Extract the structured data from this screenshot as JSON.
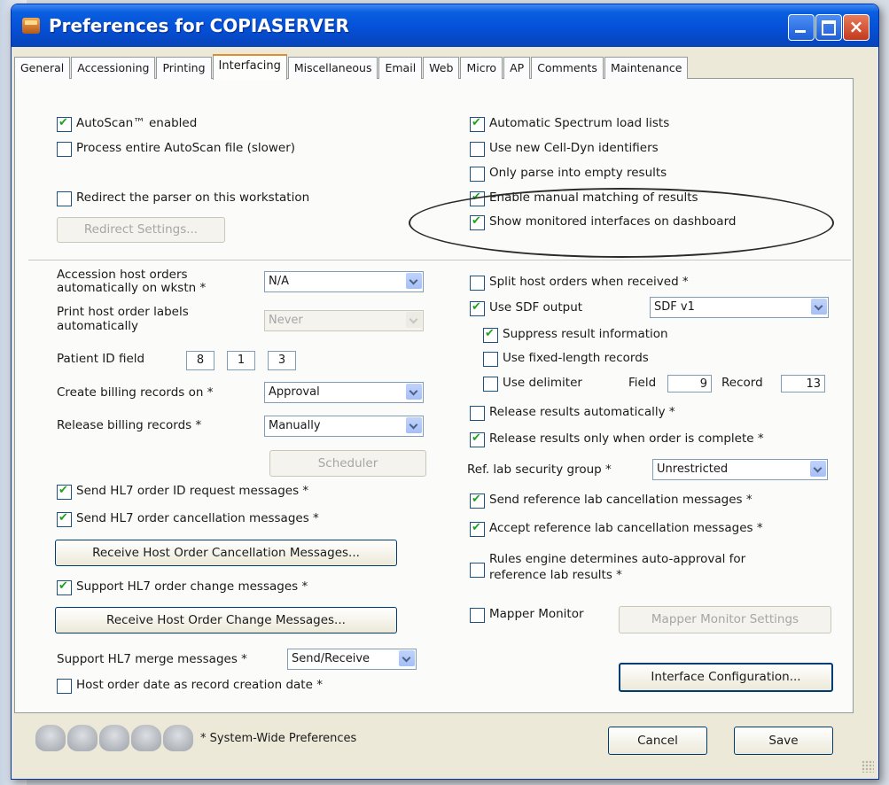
{
  "window": {
    "title": "Preferences for COPIASERVER"
  },
  "tabs": [
    "General",
    "Accessioning",
    "Printing",
    "Interfacing",
    "Miscellaneous",
    "Email",
    "Web",
    "Micro",
    "AP",
    "Comments",
    "Maintenance"
  ],
  "top_left": {
    "autoscan": "AutoScan™ enabled",
    "process_file": "Process entire AutoScan file (slower)",
    "redirect": "Redirect the parser on this workstation",
    "redirect_button": "Redirect Settings..."
  },
  "top_right": {
    "spectrum": "Automatic Spectrum load lists",
    "celldyn": "Use new Cell-Dyn identifiers",
    "parse": "Only parse into empty results",
    "manual": "Enable manual matching of results",
    "monitored": "Show monitored interfaces on dashboard"
  },
  "left": {
    "accession_label": "Accession host orders automatically on wkstn *",
    "accession_value": "N/A",
    "print_label": "Print host order labels automatically",
    "print_value": "Never",
    "patient_label": "Patient ID field",
    "patient_fields": [
      "8",
      "1",
      "3"
    ],
    "billing_label": "Create billing records on *",
    "billing_value": "Approval",
    "release_label": "Release billing records *",
    "release_value": "Manually",
    "scheduler": "Scheduler",
    "hl7_id": "Send HL7 order ID request messages *",
    "hl7_cancel": "Send HL7 order cancellation messages *",
    "receive_cancel_button": "Receive Host Order Cancellation Messages...",
    "hl7_change": "Support HL7 order change messages *",
    "receive_change_button": "Receive Host Order Change Messages...",
    "merge_label": "Support HL7 merge messages *",
    "merge_value": "Send/Receive",
    "host_date": "Host order date as record creation date *"
  },
  "right": {
    "split": "Split host orders when received *",
    "sdf": "Use SDF output",
    "sdf_value": "SDF v1",
    "suppress": "Suppress result information",
    "fixed": "Use fixed-length records",
    "delimiter": "Use delimiter",
    "field_label": "Field",
    "field_value": "9",
    "record_label": "Record",
    "record_value": "13",
    "release_auto": "Release results automatically *",
    "release_complete": "Release results only when order is complete *",
    "security_label": "Ref. lab security group *",
    "security_value": "Unrestricted",
    "send_ref_cancel": "Send reference lab cancellation messages *",
    "accept_ref_cancel": "Accept reference lab cancellation messages *",
    "rules_line1": "Rules engine determines auto-approval for",
    "rules_line2": "reference lab results *",
    "mapper": "Mapper Monitor",
    "mapper_settings": "Mapper Monitor Settings",
    "interface_config": "Interface Configuration..."
  },
  "footer": {
    "note": "* System-Wide Preferences",
    "cancel": "Cancel",
    "save": "Save"
  }
}
